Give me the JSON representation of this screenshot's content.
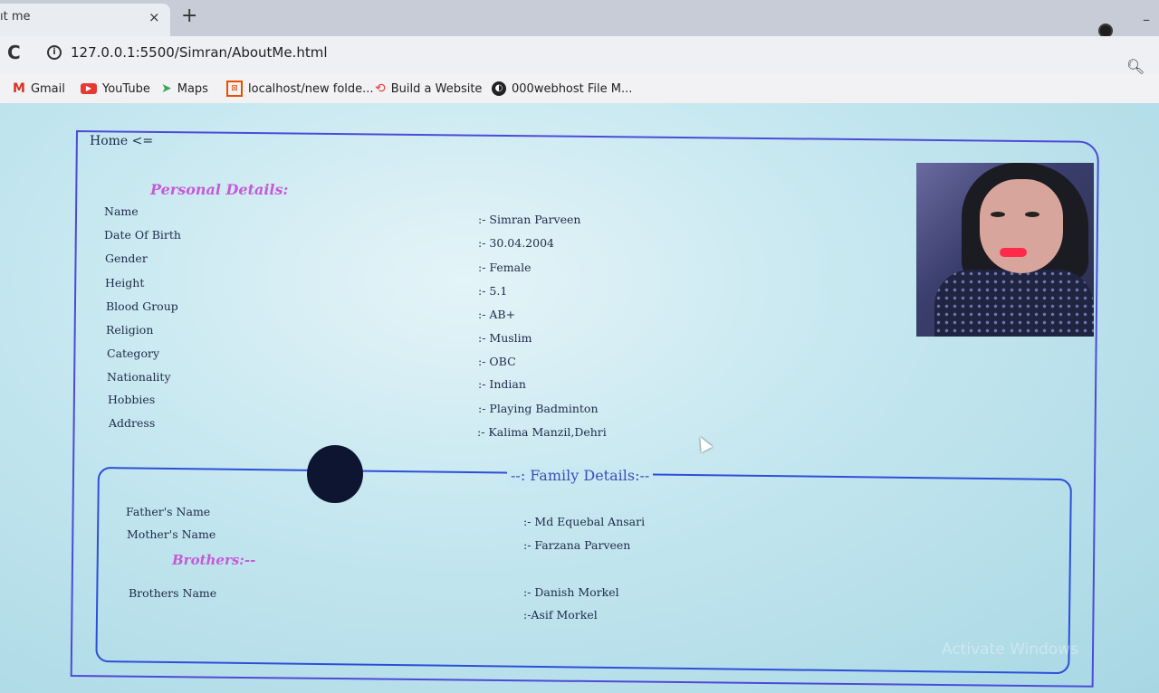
{
  "browser": {
    "tab_title": "ıt me",
    "tab_close": "×",
    "new_tab": "+",
    "url": "127.0.0.1:5500/Simran/AboutMe.html",
    "bookmarks": [
      {
        "label": "Gmail",
        "icon": "gmail-icon"
      },
      {
        "label": "YouTube",
        "icon": "youtube-icon"
      },
      {
        "label": "Maps",
        "icon": "maps-icon"
      },
      {
        "label": "localhost/new folde...",
        "icon": "localhost-icon"
      },
      {
        "label": "Build a Website",
        "icon": "build-website-icon"
      },
      {
        "label": "000webhost File M...",
        "icon": "webhost-icon"
      }
    ]
  },
  "page": {
    "home_link": "Home <=",
    "personal": {
      "title": "Personal Details:",
      "rows": [
        {
          "label": "Name",
          "value": ":- Simran Parveen"
        },
        {
          "label": "Date Of Birth",
          "value": ":- 30.04.2004"
        },
        {
          "label": "Gender",
          "value": ":- Female"
        },
        {
          "label": "Height",
          "value": ":- 5.1"
        },
        {
          "label": "Blood Group",
          "value": ":- AB+"
        },
        {
          "label": "Religion",
          "value": ":- Muslim"
        },
        {
          "label": "Category",
          "value": ":- OBC"
        },
        {
          "label": "Nationality",
          "value": ":- Indian"
        },
        {
          "label": "Hobbies",
          "value": ":- Playing Badminton"
        },
        {
          "label": "Address",
          "value": ":- Kalima Manzil,Dehri"
        }
      ]
    },
    "family": {
      "title": "--: Family Details:--",
      "father_label": "Father's Name",
      "father_value": ":- Md Equebal Ansari",
      "mother_label": "Mother's Name",
      "mother_value": ":- Farzana Parveen",
      "brothers_title": "Brothers:--",
      "brothers_label": "Brothers Name",
      "brothers_values": [
        ":- Danish Morkel",
        ":-Asif Morkel"
      ]
    },
    "watermark": "Activate Windows"
  }
}
